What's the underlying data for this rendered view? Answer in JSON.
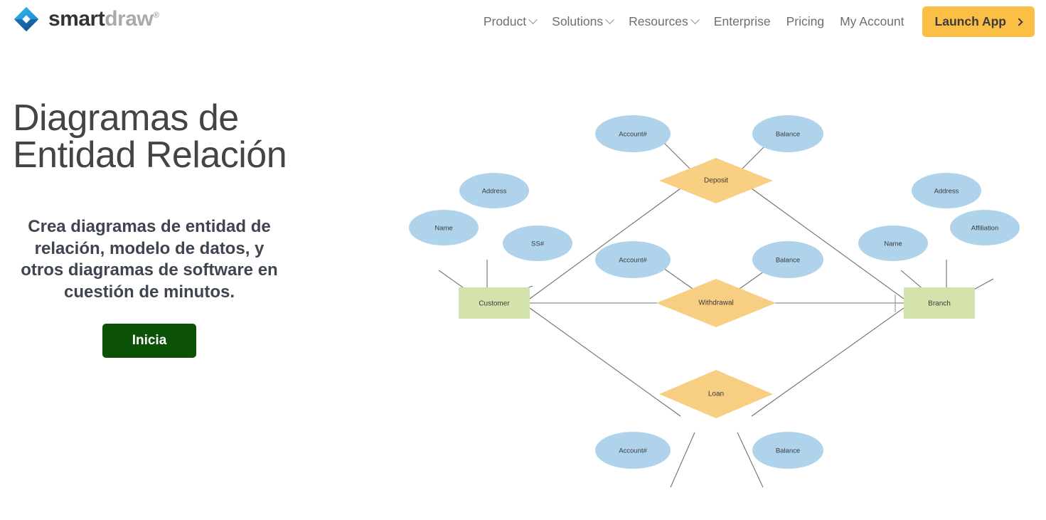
{
  "header": {
    "brand": {
      "name_part1": "smart",
      "name_part2": "draw",
      "trademark": "®",
      "logo_icon": "smartdraw-diamond-logo"
    },
    "nav": [
      {
        "label": "Product",
        "has_dropdown": true
      },
      {
        "label": "Solutions",
        "has_dropdown": true
      },
      {
        "label": "Resources",
        "has_dropdown": true
      },
      {
        "label": "Enterprise",
        "has_dropdown": false
      },
      {
        "label": "Pricing",
        "has_dropdown": false
      },
      {
        "label": "My Account",
        "has_dropdown": false
      }
    ],
    "launch_button": {
      "label": "Launch App",
      "icon": "chevron-right-icon",
      "bg_color": "#FBBF45",
      "text_color": "#3b3b3b"
    }
  },
  "hero": {
    "title": "Diagramas de Entidad Relación",
    "subtitle": "Crea diagramas de entidad de relación, modelo de datos, y otros diagramas de software en cuestión de minutos.",
    "cta_label": "Inicia",
    "cta_bg_color": "#0b5207",
    "title_color": "#444444"
  },
  "diagram": {
    "type": "entity-relationship-diagram",
    "colors": {
      "entity": "#D4E3AC",
      "relationship": "#F8CE82",
      "attribute": "#AFD3EA",
      "connector": "#6f6f6f"
    },
    "entities": [
      {
        "id": "customer",
        "label": "Customer"
      },
      {
        "id": "branch",
        "label": "Branch"
      }
    ],
    "relationships": [
      {
        "id": "deposit",
        "label": "Deposit",
        "connects": [
          "customer",
          "branch"
        ]
      },
      {
        "id": "withdrawal",
        "label": "Withdrawal",
        "connects": [
          "customer",
          "branch"
        ]
      },
      {
        "id": "loan",
        "label": "Loan",
        "connects": [
          "customer",
          "branch"
        ]
      }
    ],
    "attributes": [
      {
        "id": "deposit-account",
        "label": "Account#",
        "owner": "deposit"
      },
      {
        "id": "deposit-balance",
        "label": "Balance",
        "owner": "deposit"
      },
      {
        "id": "customer-address",
        "label": "Address",
        "owner": "customer"
      },
      {
        "id": "customer-name",
        "label": "Name",
        "owner": "customer"
      },
      {
        "id": "customer-ss",
        "label": "SS#",
        "owner": "customer"
      },
      {
        "id": "withdrawal-account",
        "label": "Account#",
        "owner": "withdrawal"
      },
      {
        "id": "withdrawal-balance",
        "label": "Balance",
        "owner": "withdrawal"
      },
      {
        "id": "branch-address",
        "label": "Address",
        "owner": "branch"
      },
      {
        "id": "branch-name",
        "label": "Name",
        "owner": "branch"
      },
      {
        "id": "branch-affiliation",
        "label": "Affiliation",
        "owner": "branch"
      },
      {
        "id": "loan-account",
        "label": "Account#",
        "owner": "loan"
      },
      {
        "id": "loan-balance",
        "label": "Balance",
        "owner": "loan"
      }
    ]
  }
}
